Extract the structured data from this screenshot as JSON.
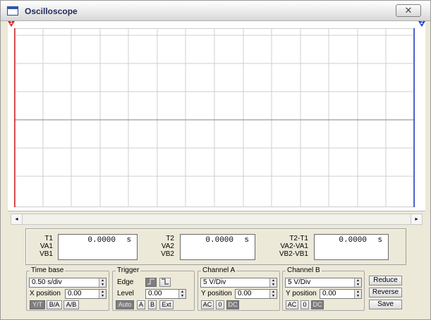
{
  "window": {
    "title": "Oscilloscope",
    "close_glyph": "✕"
  },
  "markers": {
    "cursor1": "1",
    "cursor2": "2"
  },
  "scrollbar": {
    "left_glyph": "◂",
    "right_glyph": "▸"
  },
  "readouts": {
    "t1": {
      "labels": [
        "T1",
        "VA1",
        "VB1"
      ],
      "value": "0.0000",
      "unit": "s"
    },
    "t2": {
      "labels": [
        "T2",
        "VA2",
        "VB2"
      ],
      "value": "0.0000",
      "unit": "s"
    },
    "diff": {
      "labels": [
        "T2-T1",
        "VA2-VA1",
        "VB2-VB1"
      ],
      "value": "0.0000",
      "unit": "s"
    }
  },
  "timebase": {
    "title": "Time base",
    "value": "0.50 s/div",
    "xpos_label": "X position",
    "xpos_value": "0.00",
    "buttons": [
      "Y/T",
      "B/A",
      "A/B"
    ]
  },
  "trigger": {
    "title": "Trigger",
    "edge_label": "Edge",
    "level_label": "Level",
    "level_value": "0.00",
    "buttons": [
      "Auto",
      "A",
      "B",
      "Ext"
    ]
  },
  "channel_a": {
    "title": "Channel A",
    "value": "5 V/Div",
    "ypos_label": "Y position",
    "ypos_value": "0.00",
    "buttons": [
      "AC",
      "0",
      "DC"
    ]
  },
  "channel_b": {
    "title": "Channel B",
    "value": "5 V/Div",
    "ypos_label": "Y position",
    "ypos_value": "0.00",
    "buttons": [
      "AC",
      "0",
      "DC"
    ]
  },
  "actions": {
    "reduce": "Reduce",
    "reverse": "Reverse",
    "save": "Save"
  },
  "colors": {
    "cursor1": "#e02020",
    "cursor2": "#2040d0",
    "grid": "#c8c8c8",
    "axis": "#808080"
  }
}
